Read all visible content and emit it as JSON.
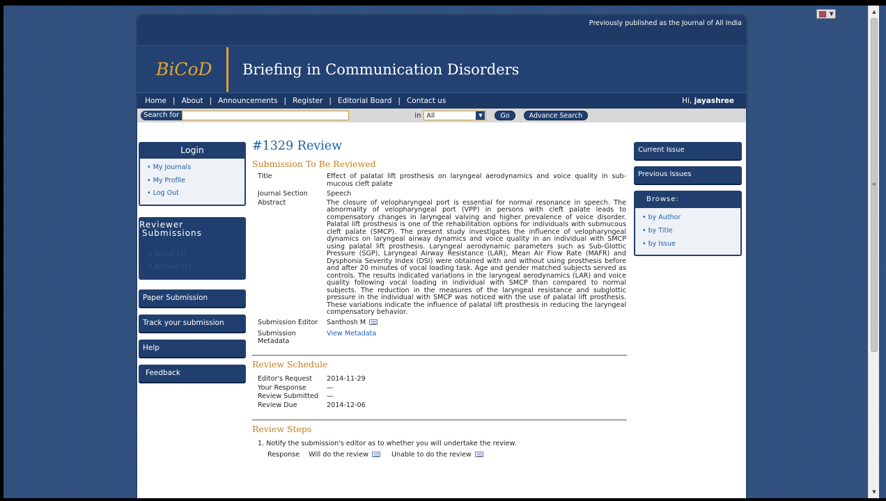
{
  "page": {
    "top_notice": "Previously published as the Journal of All India",
    "logo": "BiCoD",
    "journal_title": "Briefing in Communication Disorders"
  },
  "nav": {
    "items": [
      "Home",
      "About",
      "Announcements",
      "Register",
      "Editorial Board",
      "Contact us"
    ],
    "separator": "|",
    "greeting": "Hi,",
    "username": "jayashree"
  },
  "search": {
    "label": "Search for",
    "value": "",
    "in_label": "in",
    "scope_selected": "All",
    "go_label": "Go",
    "advanced_label": "Advance Search"
  },
  "left_sidebar": {
    "login_title": "Login",
    "login_links": [
      "• My Journals",
      "• My Profile",
      "• Log Out"
    ],
    "reviewer_title_line1": "Reviewer",
    "reviewer_title_line2": "Submissions",
    "reviewer_links": [
      "• Active (1)",
      "• Archive (1)"
    ],
    "boxes": [
      "Paper Submission",
      "Track your submission",
      "Help",
      "Feedback"
    ]
  },
  "main": {
    "heading": "#1329 Review",
    "section1_title": "Submission To Be Reviewed",
    "fields": {
      "title_label": "Title",
      "title_value": "Effect of palatal lift prosthesis on laryngeal aerodynamics and voice quality in sub-mucous cleft palate",
      "journal_section_label": "Journal Section",
      "journal_section_value": "Speech",
      "abstract_label": "Abstract",
      "abstract_value": "The closure of velopharyngeal port is essential for normal resonance in speech. The abnormality of velopharyngeal port (VPP) in persons with cleft palate leads to compensatory changes in laryngeal valving and higher prevalence of voice disorder. Palatal lift prosthesis is one of the rehabilitation options for individuals with submucous cleft palate (SMCP). The present study investigates the influence of velopharyngeal dynamics on laryngeal airway dynamics and voice quality in an individual with SMCP using palatal lift prosthesis. Laryngeal aerodynamic parameters such as Sub-Glottic Pressure (SGP), Laryngeal Airway Resistance (LAR), Mean Air Flow Rate (MAFR) and Dysphonia Severity Index (DSI) were obtained with and without using prosthesis before and after 20 minutes of vocal loading task. Age and gender matched subjects served as controls. The results indicated variations in the laryngeal aerodynamics (LAR) and voice quality following vocal loading in individual with SMCP than compared to normal subjects. The reduction in the measures of the laryngeal resistance and subglottic pressure in the individual with SMCP was noticed with the use of palatal lift prosthesis. These variations indicate the influence of palatal lift prosthesis in reducing the laryngeal compensatory behavior.",
      "editor_label": "Submission Editor",
      "editor_value": "Santhosh M",
      "metadata_label_line1": "Submission",
      "metadata_label_line2": "Metadata",
      "metadata_link": "View Metadata"
    },
    "section2_title": "Review Schedule",
    "schedule": [
      {
        "label": "Editor's Request",
        "value": "2014-11-29"
      },
      {
        "label": "Your Response",
        "value": "—"
      },
      {
        "label": "Review Submitted",
        "value": "—"
      },
      {
        "label": "Review Due",
        "value": "2014-12-06"
      }
    ],
    "section3_title": "Review Steps",
    "step1": "1. Notify the submission's editor as to whether you will undertake the review.",
    "response_label": "Response",
    "will_do": "Will do the review",
    "unable_to_do": "Unable to do the review"
  },
  "right_sidebar": {
    "current_issue": "Current Issue",
    "previous_issues": "Previous Issues",
    "browse_title": "Browse:",
    "browse_links": [
      "• by Author",
      "• by Title",
      "• by Issue"
    ]
  },
  "colors": {
    "header_blue": "#213f6e",
    "accent_gold": "#e4a42f",
    "section_orange": "#c47d1a",
    "link_blue": "#1f5fa8"
  }
}
